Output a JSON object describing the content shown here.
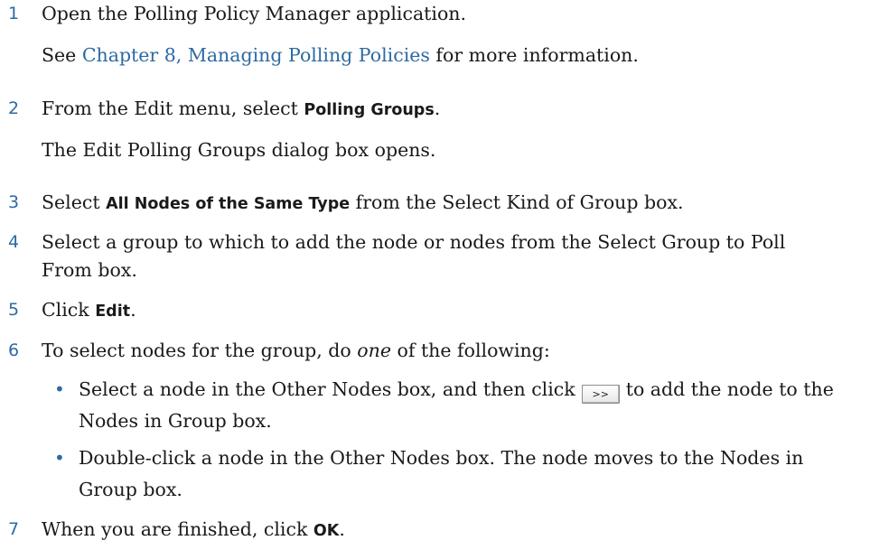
{
  "steps": [
    {
      "num": "1",
      "text": "Open the Polling Policy Manager application."
    },
    {
      "see_prefix": "See ",
      "link": "Chapter 8, Managing Polling Policies",
      "see_suffix": " for more information."
    },
    {
      "num": "2",
      "pre": "From the Edit menu, select ",
      "ui": "Polling Groups",
      "post": "."
    },
    {
      "text": "The Edit Polling Groups dialog box opens."
    },
    {
      "num": "3",
      "pre": "Select ",
      "ui": "All Nodes of the Same Type",
      "post": " from the Select Kind of Group box."
    },
    {
      "num": "4",
      "text": "Select a group to which to add the node or nodes from the Select Group to Poll From box."
    },
    {
      "num": "5",
      "pre": "Click ",
      "ui": "Edit",
      "post": "."
    },
    {
      "num": "6",
      "pre": "To select nodes for the group, do ",
      "em": "one",
      "post": " of the following:"
    },
    {
      "num": "7",
      "pre": "When you are finished, click ",
      "ui": "OK",
      "post": "."
    }
  ],
  "bullets": [
    {
      "pre": "Select a node in the Other Nodes box, and then click",
      "button": ">>",
      "post": "to add the node to the Nodes in Group box."
    },
    {
      "text": "Double-click a node in the Other Nodes box. The node moves to the Nodes in Group box."
    }
  ],
  "bullet_char": "•"
}
